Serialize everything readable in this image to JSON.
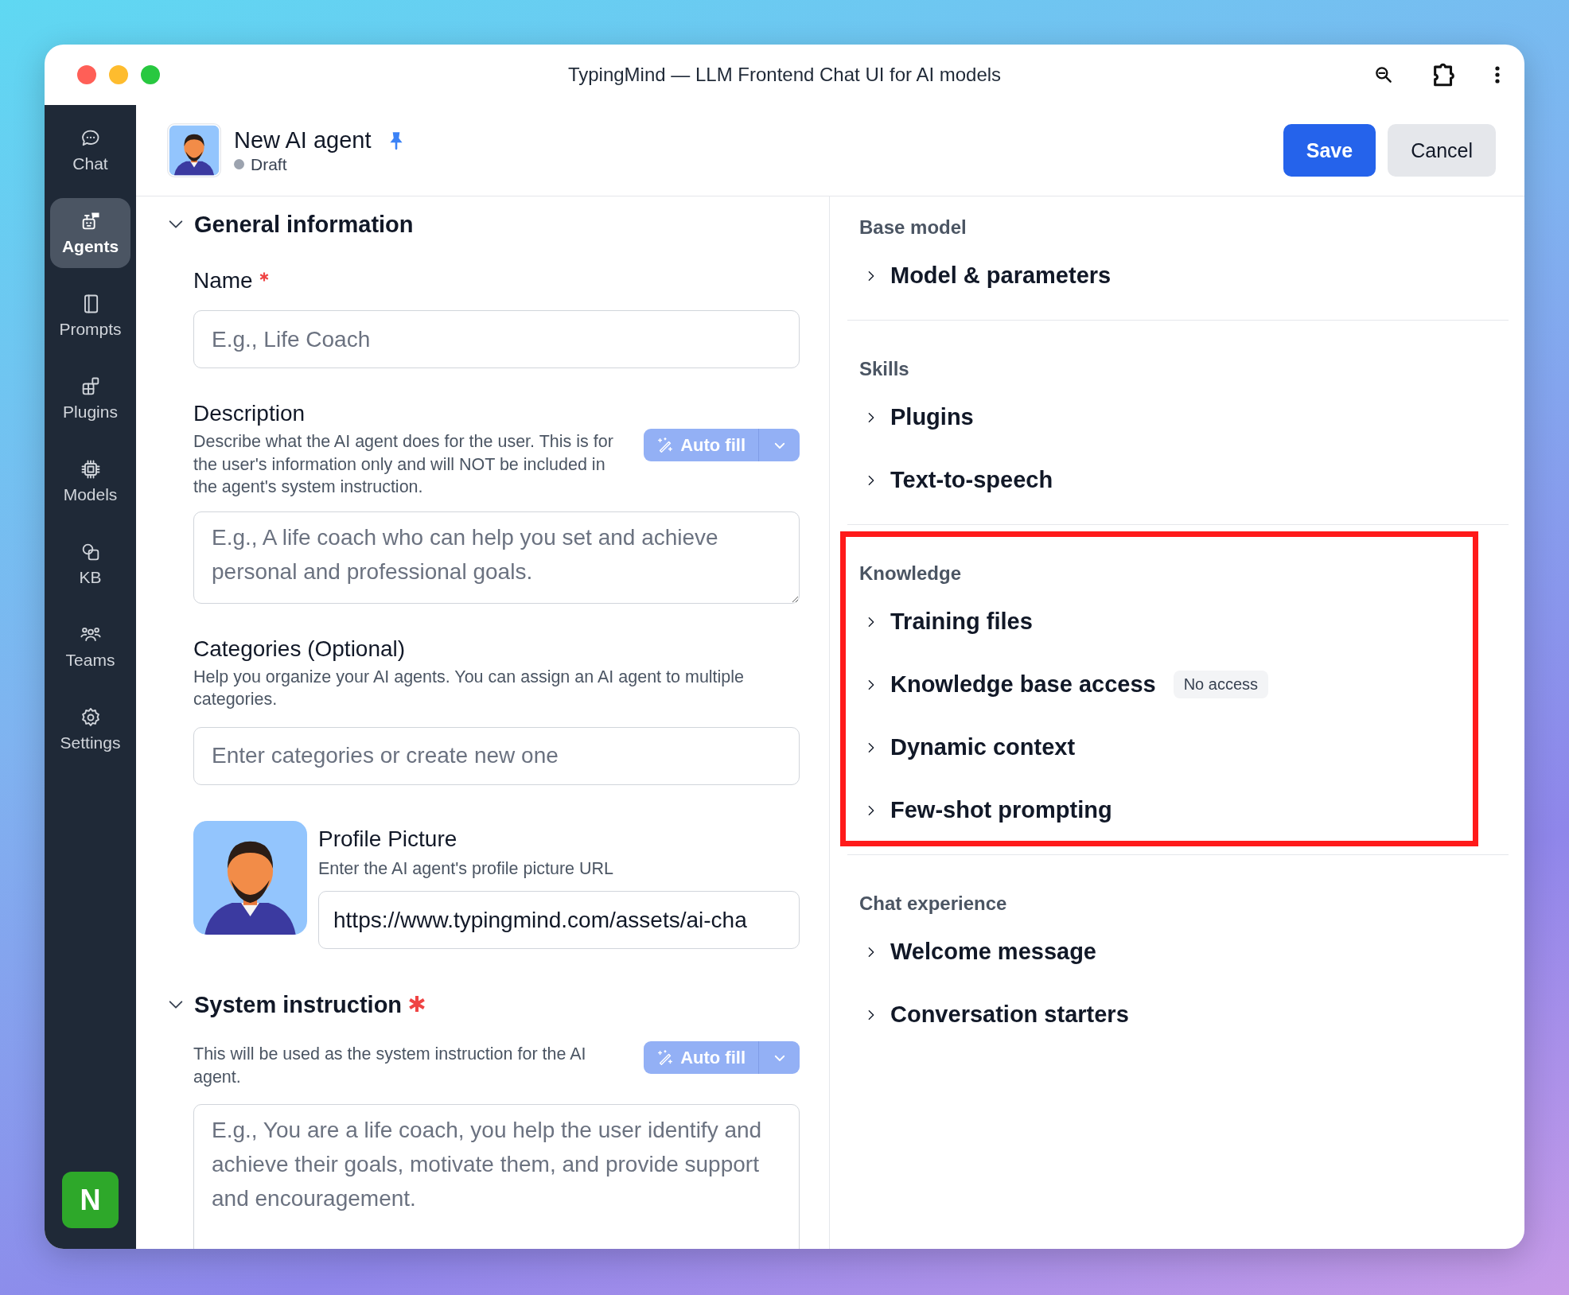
{
  "window": {
    "title": "TypingMind — LLM Frontend Chat UI for AI models"
  },
  "sidebar": {
    "items": [
      {
        "kind": "chat",
        "label": "Chat",
        "selected": false
      },
      {
        "kind": "agents",
        "label": "Agents",
        "selected": true
      },
      {
        "kind": "prompts",
        "label": "Prompts",
        "selected": false
      },
      {
        "kind": "plugins",
        "label": "Plugins",
        "selected": false
      },
      {
        "kind": "models",
        "label": "Models",
        "selected": false
      },
      {
        "kind": "kb",
        "label": "KB",
        "selected": false
      },
      {
        "kind": "teams",
        "label": "Teams",
        "selected": false
      },
      {
        "kind": "settings",
        "label": "Settings",
        "selected": false
      }
    ],
    "user_avatar": {
      "initial": "N"
    }
  },
  "header": {
    "title": "New AI agent",
    "pinned": true,
    "status": "Draft",
    "buttons": [
      {
        "kind": "primary",
        "label": "Save"
      },
      {
        "kind": "secondary",
        "label": "Cancel"
      }
    ]
  },
  "general": {
    "title": "General information",
    "expanded": true,
    "fields": [
      {
        "kind": "input",
        "label": "Name",
        "required": true,
        "placeholder": "E.g., Life Coach"
      },
      {
        "kind": "textarea",
        "label": "Description",
        "required": false,
        "help": "Describe what the AI agent does for the user. This is for the user's information only and will NOT be included in the agent's system instruction.",
        "autofill": "Auto fill",
        "placeholder": "E.g., A life coach who can help you set and achieve personal and professional goals."
      },
      {
        "kind": "input",
        "label": "Categories (Optional)",
        "required": false,
        "help": "Help you organize your AI agents. You can assign an AI agent to multiple categories.",
        "placeholder": "Enter categories or create new one"
      },
      {
        "kind": "picture",
        "label": "Profile Picture",
        "required": false,
        "help": "Enter the AI agent's profile picture URL",
        "value": "https://www.typingmind.com/assets/ai-cha"
      }
    ]
  },
  "system_instruction": {
    "title": "System instruction",
    "required": true,
    "expanded": true,
    "help": "This will be used as the system instruction for the AI agent.",
    "autofill": "Auto fill",
    "placeholder": "E.g., You are a life coach, you help the user identify and achieve their goals, motivate them, and provide support and encouragement."
  },
  "sections": [
    {
      "title": "Base model",
      "highlighted": false,
      "items": [
        {
          "label": "Model & parameters",
          "expanded": false
        }
      ]
    },
    {
      "title": "Skills",
      "highlighted": false,
      "items": [
        {
          "label": "Plugins",
          "expanded": false
        },
        {
          "label": "Text-to-speech",
          "expanded": false
        }
      ]
    },
    {
      "title": "Knowledge",
      "highlighted": true,
      "items": [
        {
          "label": "Training files",
          "expanded": false
        },
        {
          "label": "Knowledge base access",
          "expanded": false,
          "badge": "No access"
        },
        {
          "label": "Dynamic context",
          "expanded": false
        },
        {
          "label": "Few-shot prompting",
          "expanded": false
        }
      ]
    },
    {
      "title": "Chat experience",
      "highlighted": false,
      "items": [
        {
          "label": "Welcome message",
          "expanded": false
        },
        {
          "label": "Conversation starters",
          "expanded": false
        }
      ]
    }
  ]
}
